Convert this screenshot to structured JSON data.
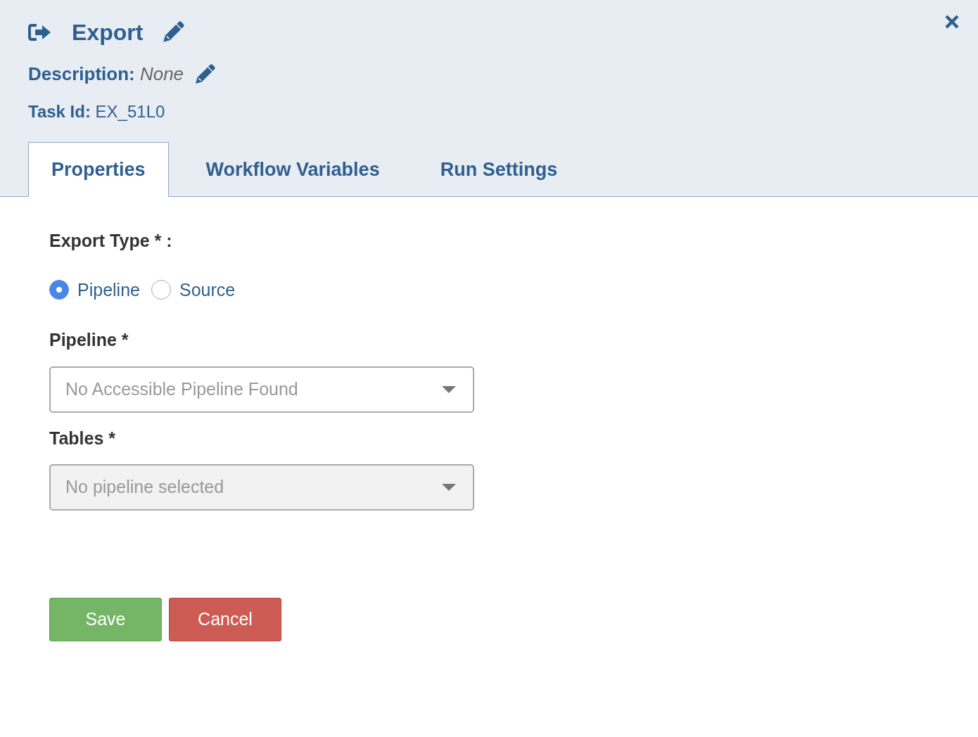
{
  "header": {
    "title": "Export",
    "description_label": "Description:",
    "description_value": "None",
    "task_id_label": "Task Id:",
    "task_id_value": "EX_51L0"
  },
  "tabs": [
    {
      "label": "Properties",
      "selected": true
    },
    {
      "label": "Workflow Variables",
      "selected": false
    },
    {
      "label": "Run Settings",
      "selected": false
    }
  ],
  "export_type": {
    "label": "Export Type * :",
    "options": [
      {
        "label": "Pipeline",
        "selected": true
      },
      {
        "label": "Source",
        "selected": false
      }
    ]
  },
  "fields": [
    {
      "label": "Pipeline *",
      "placeholder": "No Accessible Pipeline Found",
      "disabled": false
    },
    {
      "label": "Tables *",
      "placeholder": "No pipeline selected",
      "disabled": true
    }
  ],
  "buttons": [
    {
      "label": "Save",
      "kind": "primary"
    },
    {
      "label": "Cancel",
      "kind": "danger"
    }
  ]
}
